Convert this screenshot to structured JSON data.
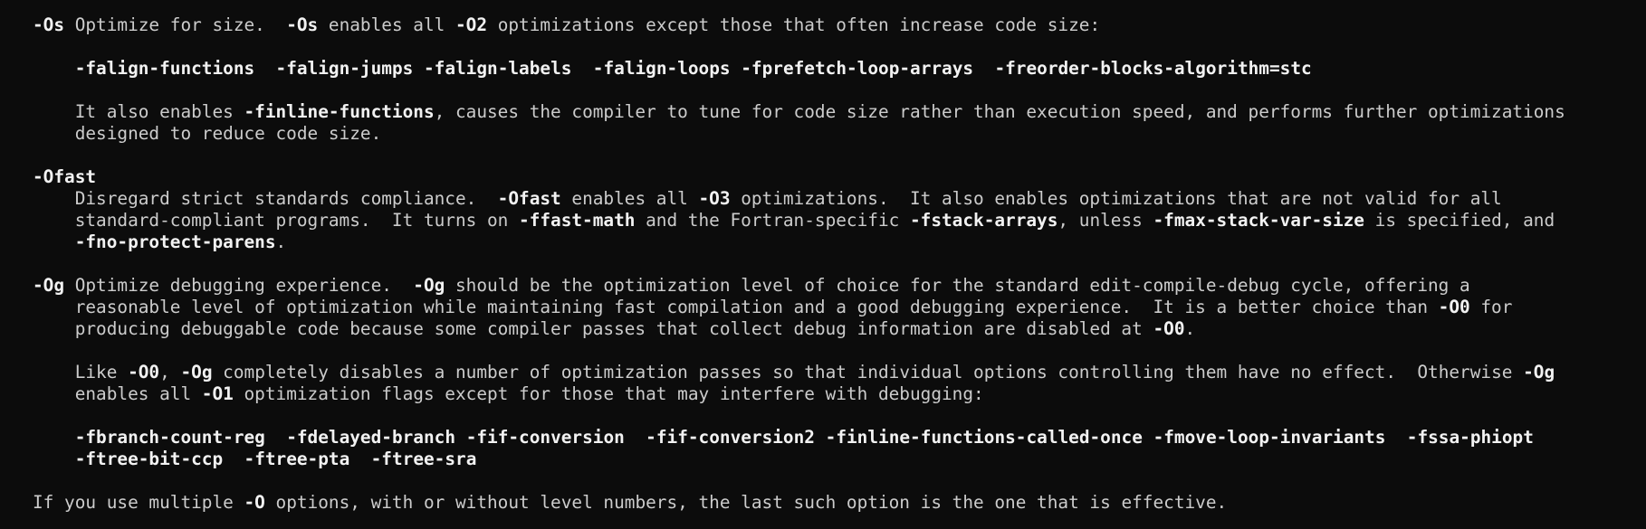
{
  "terminal": {
    "colors": {
      "background": "#0c0c0c",
      "text": "#cccccc",
      "bold_text": "#f2f2f2"
    },
    "lines": [
      [
        {
          "t": "-Os",
          "b": true
        },
        {
          "t": " Optimize for size.  "
        },
        {
          "t": "-Os",
          "b": true
        },
        {
          "t": " enables all "
        },
        {
          "t": "-O2",
          "b": true
        },
        {
          "t": " optimizations except those that often increase code size:"
        }
      ],
      [],
      [
        {
          "t": "    "
        },
        {
          "t": "-falign-functions",
          "b": true
        },
        {
          "t": "  "
        },
        {
          "t": "-falign-jumps",
          "b": true
        },
        {
          "t": " "
        },
        {
          "t": "-falign-labels",
          "b": true
        },
        {
          "t": "  "
        },
        {
          "t": "-falign-loops",
          "b": true
        },
        {
          "t": " "
        },
        {
          "t": "-fprefetch-loop-arrays",
          "b": true
        },
        {
          "t": "  "
        },
        {
          "t": "-freorder-blocks-algorithm=stc",
          "b": true
        }
      ],
      [],
      [
        {
          "t": "    It also enables "
        },
        {
          "t": "-finline-functions",
          "b": true
        },
        {
          "t": ", causes the compiler to tune for code size rather than execution speed, and performs further optimizations"
        }
      ],
      [
        {
          "t": "    designed to reduce code size."
        }
      ],
      [],
      [
        {
          "t": "-Ofast",
          "b": true
        }
      ],
      [
        {
          "t": "    Disregard strict standards compliance.  "
        },
        {
          "t": "-Ofast",
          "b": true
        },
        {
          "t": " enables all "
        },
        {
          "t": "-O3",
          "b": true
        },
        {
          "t": " optimizations.  It also enables optimizations that are not valid for all"
        }
      ],
      [
        {
          "t": "    standard-compliant programs.  It turns on "
        },
        {
          "t": "-ffast-math",
          "b": true
        },
        {
          "t": " and the Fortran-specific "
        },
        {
          "t": "-fstack-arrays",
          "b": true
        },
        {
          "t": ", unless "
        },
        {
          "t": "-fmax-stack-var-size",
          "b": true
        },
        {
          "t": " is specified, and"
        }
      ],
      [
        {
          "t": "    "
        },
        {
          "t": "-fno-protect-parens",
          "b": true
        },
        {
          "t": "."
        }
      ],
      [],
      [
        {
          "t": "-Og",
          "b": true
        },
        {
          "t": " Optimize debugging experience.  "
        },
        {
          "t": "-Og",
          "b": true
        },
        {
          "t": " should be the optimization level of choice for the standard edit-compile-debug cycle, offering a"
        }
      ],
      [
        {
          "t": "    reasonable level of optimization while maintaining fast compilation and a good debugging experience.  It is a better choice than "
        },
        {
          "t": "-O0",
          "b": true
        },
        {
          "t": " for"
        }
      ],
      [
        {
          "t": "    producing debuggable code because some compiler passes that collect debug information are disabled at "
        },
        {
          "t": "-O0",
          "b": true
        },
        {
          "t": "."
        }
      ],
      [],
      [
        {
          "t": "    Like "
        },
        {
          "t": "-O0",
          "b": true
        },
        {
          "t": ", "
        },
        {
          "t": "-Og",
          "b": true
        },
        {
          "t": " completely disables a number of optimization passes so that individual options controlling them have no effect.  Otherwise "
        },
        {
          "t": "-Og",
          "b": true
        }
      ],
      [
        {
          "t": "    enables all "
        },
        {
          "t": "-O1",
          "b": true
        },
        {
          "t": " optimization flags except for those that may interfere with debugging:"
        }
      ],
      [],
      [
        {
          "t": "    "
        },
        {
          "t": "-fbranch-count-reg",
          "b": true
        },
        {
          "t": "  "
        },
        {
          "t": "-fdelayed-branch",
          "b": true
        },
        {
          "t": " "
        },
        {
          "t": "-fif-conversion",
          "b": true
        },
        {
          "t": "  "
        },
        {
          "t": "-fif-conversion2",
          "b": true
        },
        {
          "t": " "
        },
        {
          "t": "-finline-functions-called-once",
          "b": true
        },
        {
          "t": " "
        },
        {
          "t": "-fmove-loop-invariants",
          "b": true
        },
        {
          "t": "  "
        },
        {
          "t": "-fssa-phiopt",
          "b": true
        }
      ],
      [
        {
          "t": "    "
        },
        {
          "t": "-ftree-bit-ccp",
          "b": true
        },
        {
          "t": "  "
        },
        {
          "t": "-ftree-pta",
          "b": true
        },
        {
          "t": "  "
        },
        {
          "t": "-ftree-sra",
          "b": true
        }
      ],
      [],
      [
        {
          "t": "If you use multiple "
        },
        {
          "t": "-O",
          "b": true
        },
        {
          "t": " options, with or without level numbers, the last such option is the one that is effective."
        }
      ]
    ]
  }
}
